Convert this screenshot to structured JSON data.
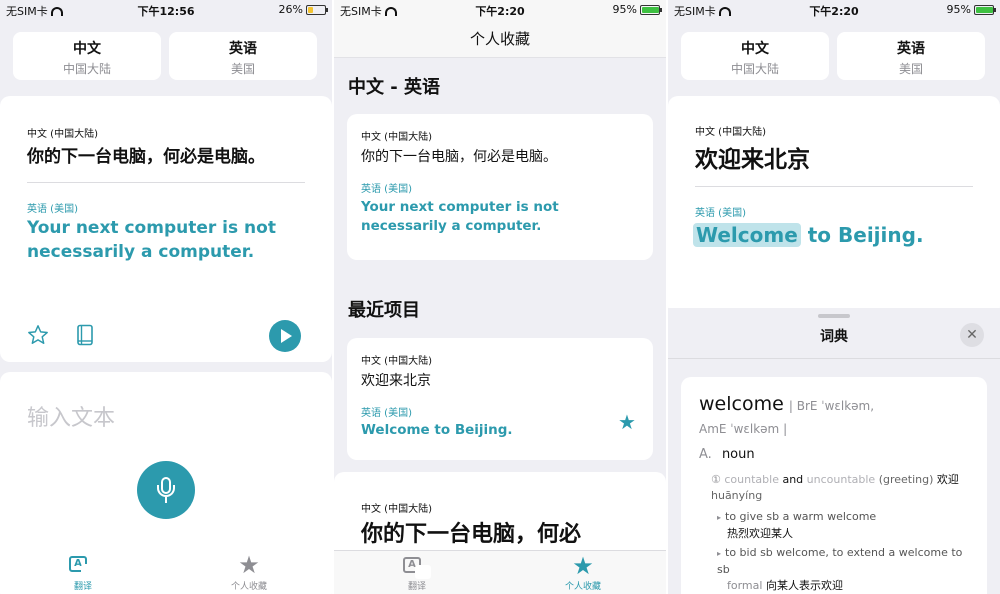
{
  "panel1": {
    "status": {
      "carrier": "无SIM卡",
      "time": "下午12:56",
      "battery": "26%"
    },
    "source_lang": {
      "name": "中文",
      "region": "中国大陆"
    },
    "target_lang": {
      "name": "英语",
      "region": "美国"
    },
    "card": {
      "source_label": "中文 (中国大陆)",
      "source_text": "你的下一台电脑，何必是电脑。",
      "target_label": "英语 (美国)",
      "target_text": "Your next computer is not necessarily a computer."
    },
    "input_placeholder": "输入文本",
    "tabs": [
      {
        "label": "翻译"
      },
      {
        "label": "个人收藏"
      }
    ]
  },
  "panel2": {
    "status": {
      "carrier": "无SIM卡",
      "time": "下午2:20",
      "battery": "95%"
    },
    "nav_title": "个人收藏",
    "favorites_section": "中文 - 英语",
    "favorite_card": {
      "source_label": "中文 (中国大陆)",
      "source_text": "你的下一台电脑，何必是电脑。",
      "target_label": "英语 (美国)",
      "target_text": "Your next computer is not necessarily a computer."
    },
    "recent_section": "最近项目",
    "recent_card": {
      "source_label": "中文 (中国大陆)",
      "source_text": "欢迎来北京",
      "target_label": "英语 (美国)",
      "target_text": "Welcome to Beijing."
    },
    "partial_card": {
      "source_label": "中文 (中国大陆)",
      "source_text": "你的下一台电脑，何必"
    },
    "tabs": [
      {
        "label": "翻译"
      },
      {
        "label": "个人收藏"
      }
    ]
  },
  "panel3": {
    "status": {
      "carrier": "无SIM卡",
      "time": "下午2:20",
      "battery": "95%"
    },
    "source_lang": {
      "name": "中文",
      "region": "中国大陆"
    },
    "target_lang": {
      "name": "英语",
      "region": "美国"
    },
    "card": {
      "source_label": "中文 (中国大陆)",
      "source_text": "欢迎来北京",
      "target_label": "英语 (美国)",
      "target_highlight": "Welcome",
      "target_rest": " to Beijing."
    },
    "dictionary": {
      "title": "词典",
      "headword": "welcome",
      "pron_bre": "| BrE ˈwɛlkəm,",
      "pron_ame": "AmE ˈwɛlkəm |",
      "pos_marker": "A.",
      "pos": "noun",
      "sense_num": "①",
      "grammar": "countable",
      "and_word": "and",
      "grammar2": "uncountable",
      "domain": "(greeting)",
      "gloss_cn": "欢迎",
      "pinyin": "huānyíng",
      "phrase1": "to give sb a warm welcome",
      "phrase1_cn": "热烈欢迎某人",
      "phrase2": "to bid sb welcome, to extend a welcome to sb",
      "register": "formal",
      "phrase2_cn": "向某人表示欢迎"
    }
  },
  "colors": {
    "accent": "#2c9aad",
    "tab_inactive": "#8e8e93",
    "background": "#efeff4"
  }
}
